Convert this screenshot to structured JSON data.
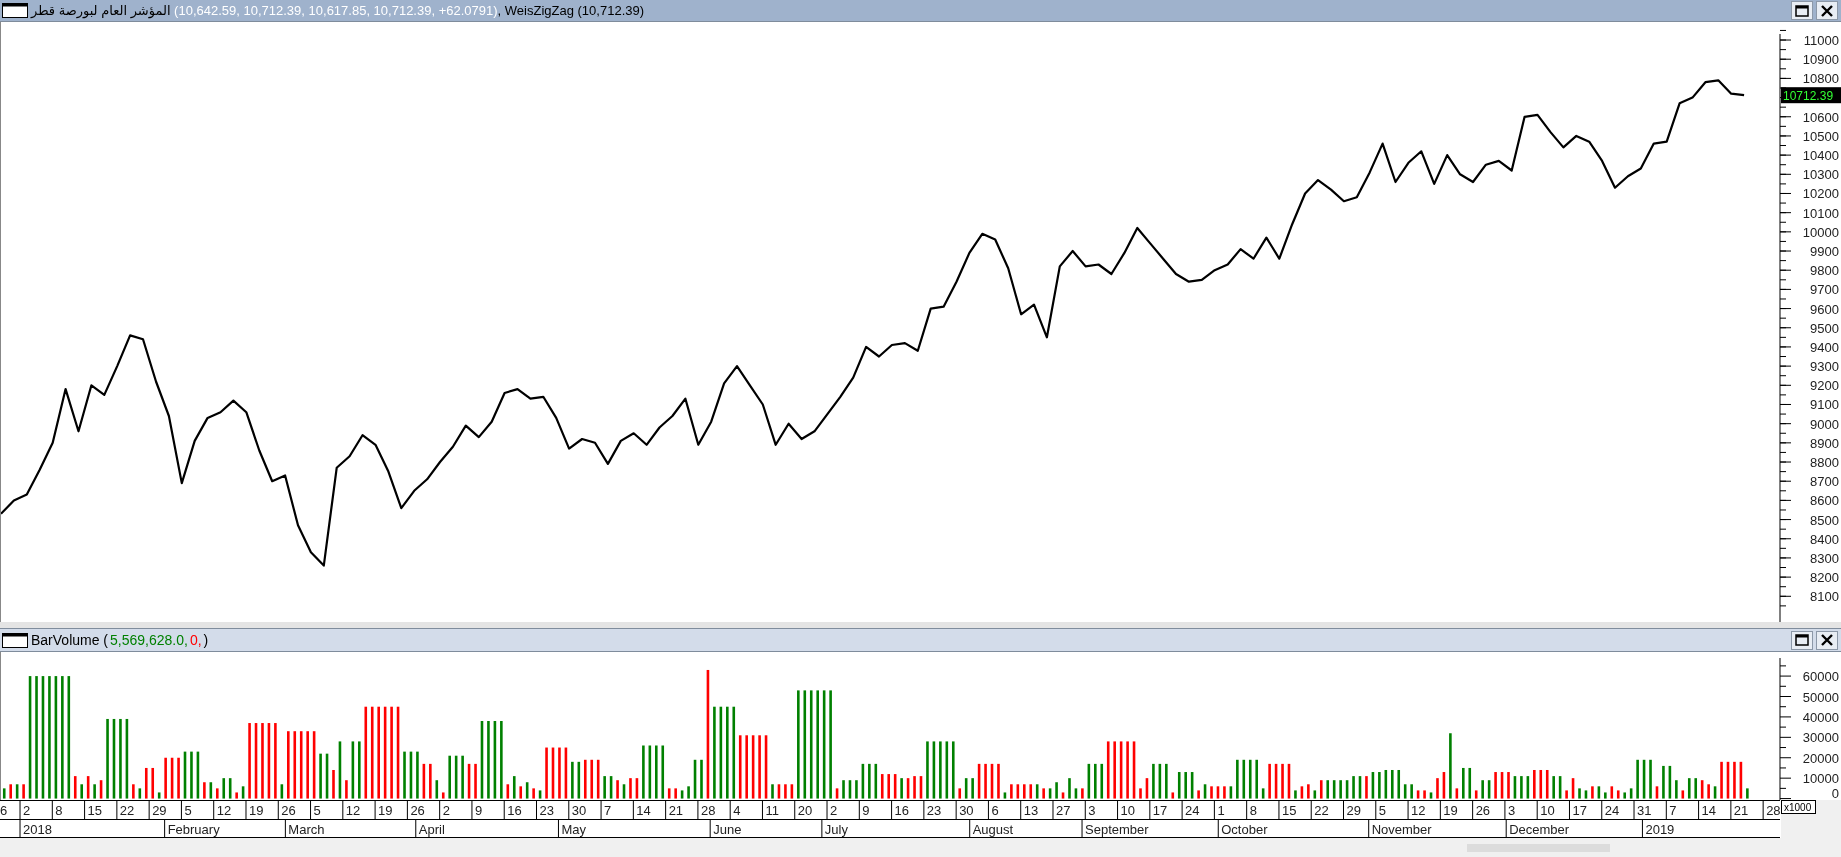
{
  "price_pane": {
    "title": [
      {
        "text": "المؤشر العام لبورصة قطر",
        "color": "#000000"
      },
      {
        "text": " (10,642.59, 10,712.39, 10,617.85, 10,712.39, +62.0791)",
        "color": "#ffffff"
      },
      {
        "text": ", WeisZigZag (10,712.39)",
        "color": "#000000"
      }
    ],
    "last_value": "10712.39",
    "chart_data": {
      "type": "line",
      "ylim": [
        7966,
        11094
      ],
      "yticks": [
        {
          "value": 8100,
          "label": "8100"
        },
        {
          "value": 8200,
          "label": "8200"
        },
        {
          "value": 8300,
          "label": "8300"
        },
        {
          "value": 8400,
          "label": "8400"
        },
        {
          "value": 8500,
          "label": "8500"
        },
        {
          "value": 8600,
          "label": "8600"
        },
        {
          "value": 8700,
          "label": "8700"
        },
        {
          "value": 8800,
          "label": "8800"
        },
        {
          "value": 8900,
          "label": "8900"
        },
        {
          "value": 9000,
          "label": "9000"
        },
        {
          "value": 9100,
          "label": "9100"
        },
        {
          "value": 9200,
          "label": "9200"
        },
        {
          "value": 9300,
          "label": "9300"
        },
        {
          "value": 9400,
          "label": "9400"
        },
        {
          "value": 9500,
          "label": "9500"
        },
        {
          "value": 9600,
          "label": "9600"
        },
        {
          "value": 9700,
          "label": "9700"
        },
        {
          "value": 9800,
          "label": "9800"
        },
        {
          "value": 9900,
          "label": "9900"
        },
        {
          "value": 10000,
          "label": "10000"
        },
        {
          "value": 10100,
          "label": "10100"
        },
        {
          "value": 10200,
          "label": "10200"
        },
        {
          "value": 10300,
          "label": "10300"
        },
        {
          "value": 10400,
          "label": "10400"
        },
        {
          "value": 10500,
          "label": "10500"
        },
        {
          "value": 10600,
          "label": "10600"
        },
        {
          "value": 10800,
          "label": "10800"
        },
        {
          "value": 10900,
          "label": "10900"
        },
        {
          "value": 11000,
          "label": "11000"
        }
      ],
      "categories": [
        null,
        null,
        null,
        null,
        null,
        null,
        null,
        null,
        null,
        null,
        null,
        null,
        null,
        null,
        null,
        null,
        null,
        null,
        null,
        null,
        null,
        null,
        null,
        null,
        null,
        null,
        null,
        null,
        null,
        null,
        null,
        null,
        null,
        null,
        null,
        null,
        null,
        null,
        null,
        null,
        null,
        null,
        null,
        null,
        null,
        null,
        null,
        null,
        null,
        null,
        null,
        null,
        null,
        null,
        null,
        null,
        null,
        null,
        null,
        null,
        null,
        null,
        null,
        null,
        null,
        null,
        null,
        null,
        null,
        null,
        null,
        null,
        null,
        null,
        null,
        null,
        null,
        null,
        null,
        null,
        null,
        null,
        null,
        null,
        null,
        null,
        null,
        null,
        null,
        null,
        null,
        null,
        null,
        null,
        null,
        null,
        null,
        null,
        null,
        null,
        null,
        null,
        null,
        null,
        null,
        null,
        null,
        null,
        null,
        null,
        null,
        null,
        null,
        null,
        null,
        null,
        null,
        null,
        null,
        null,
        null,
        null,
        null,
        null,
        null,
        null,
        null,
        null,
        null,
        null,
        null,
        null,
        null,
        null,
        null,
        null
      ],
      "series": [
        {
          "color": "#000000",
          "values": [
            8530,
            8600,
            8630,
            8760,
            8900,
            9180,
            8960,
            9200,
            9150,
            9300,
            9460,
            9440,
            9220,
            9040,
            8690,
            8910,
            9030,
            9060,
            9120,
            9060,
            8860,
            8700,
            8730,
            8470,
            8330,
            8260,
            8770,
            8830,
            8940,
            8890,
            8750,
            8560,
            8650,
            8710,
            8800,
            8880,
            8990,
            8930,
            9010,
            9160,
            9180,
            9130,
            9140,
            9030,
            8870,
            8920,
            8900,
            8790,
            8910,
            8950,
            8890,
            8980,
            9040,
            9130,
            8890,
            9010,
            9210,
            9300,
            9200,
            9100,
            8890,
            9000,
            8920,
            8960,
            9050,
            9140,
            9240,
            9400,
            9350,
            9410,
            9420,
            9380,
            9600,
            9610,
            9740,
            9890,
            9990,
            9960,
            9810,
            9570,
            9620,
            9450,
            9820,
            9900,
            9820,
            9830,
            9780,
            9890,
            10020,
            9940,
            9860,
            9780,
            9740,
            9750,
            9800,
            9830,
            9910,
            9860,
            9970,
            9860,
            10040,
            10200,
            10270,
            10220,
            10160,
            10180,
            10310,
            10460,
            10260,
            10360,
            10420,
            10250,
            10400,
            10300,
            10260,
            10350,
            10370,
            10320,
            10600,
            10610,
            10520,
            10440,
            10500,
            10470,
            10370,
            10230,
            10290,
            10330,
            10460,
            10470,
            10670,
            10700,
            10780,
            10790,
            10720,
            10712.39
          ]
        }
      ]
    }
  },
  "volume_pane": {
    "title": [
      {
        "text": "BarVolume (",
        "color": "#000000"
      },
      {
        "text": "5,569,628.0,",
        "color": "#008000"
      },
      {
        "text": "0,",
        "color": "#ff0000"
      },
      {
        "text": ")",
        "color": "#000000"
      }
    ],
    "scale_label": "x1000",
    "chart_data": {
      "type": "bar",
      "stacked": true,
      "ylim": [
        -700,
        71800
      ],
      "yticks": [
        {
          "value": 0,
          "label": "0"
        },
        {
          "value": 10000,
          "label": "10000"
        },
        {
          "value": 20000,
          "label": "20000"
        },
        {
          "value": 30000,
          "label": "30000"
        },
        {
          "value": 40000,
          "label": "40000"
        },
        {
          "value": 50000,
          "label": "50000"
        },
        {
          "value": 60000,
          "label": "60000"
        }
      ],
      "series": [
        {
          "color": "#008000",
          "values": [
            5000,
            null,
            7000,
            null,
            60000,
            60000,
            60000,
            60000,
            60000,
            60000,
            60000,
            null,
            7000,
            null,
            7000,
            null,
            39000,
            39000,
            39000,
            39000,
            null,
            5000,
            null,
            null,
            3000,
            null,
            null,
            null,
            23000,
            23000,
            23000,
            null,
            8000,
            null,
            10000,
            10000,
            null,
            6000,
            null,
            null,
            null,
            null,
            null,
            7000,
            null,
            null,
            null,
            null,
            null,
            22000,
            22000,
            null,
            28000,
            null,
            28000,
            28000,
            null,
            null,
            null,
            null,
            null,
            null,
            23000,
            23000,
            23000,
            null,
            null,
            9000,
            null,
            21000,
            21000,
            21000,
            null,
            null,
            38000,
            38000,
            38000,
            38000,
            null,
            11000,
            null,
            8000,
            null,
            4000,
            null,
            null,
            null,
            null,
            18000,
            18000,
            null,
            null,
            null,
            11000,
            11000,
            null,
            7000,
            null,
            null,
            26000,
            26000,
            26000,
            26000,
            null,
            null,
            4000,
            6000,
            19000,
            19000,
            null,
            45000,
            45000,
            45000,
            45000,
            null,
            null,
            null,
            null,
            null,
            7000,
            null,
            null,
            null,
            53000,
            53000,
            53000,
            53000,
            53000,
            53000,
            null,
            9000,
            9000,
            9000,
            17000,
            17000,
            17000,
            null,
            null,
            null,
            10000,
            null,
            null,
            null,
            28000,
            28000,
            28000,
            28000,
            28000,
            null,
            10000,
            10000,
            null,
            null,
            null,
            null,
            3000,
            null,
            null,
            null,
            null,
            7000,
            null,
            5000,
            8000,
            null,
            10000,
            5000,
            null,
            17000,
            17000,
            17000,
            null,
            null,
            null,
            null,
            null,
            null,
            null,
            17000,
            17000,
            17000,
            null,
            13000,
            13000,
            13000,
            null,
            7000,
            null,
            null,
            null,
            6000,
            19000,
            19000,
            19000,
            19000,
            5000,
            null,
            null,
            null,
            null,
            4000,
            null,
            null,
            4000,
            null,
            9000,
            9000,
            9000,
            9000,
            11000,
            11000,
            null,
            13000,
            13000,
            14000,
            14000,
            14000,
            7000,
            7000,
            null,
            null,
            3000,
            null,
            null,
            32000,
            null,
            15000,
            15000,
            null,
            9000,
            9000,
            null,
            null,
            null,
            11000,
            11000,
            11000,
            null,
            null,
            null,
            11000,
            11000,
            null,
            null,
            5000,
            4000,
            null,
            6000,
            3000,
            null,
            null,
            3000,
            5000,
            19000,
            19000,
            19000,
            null,
            16000,
            16000,
            9000,
            null,
            10000,
            10000,
            null,
            null,
            6000,
            null,
            null,
            null,
            null,
            5000
          ]
        },
        {
          "color": "#ff0000",
          "values": [
            null,
            7000,
            null,
            7000,
            null,
            null,
            null,
            null,
            null,
            null,
            null,
            11000,
            null,
            11000,
            null,
            9000,
            null,
            null,
            null,
            null,
            7000,
            null,
            15000,
            15000,
            null,
            20000,
            20000,
            20000,
            null,
            null,
            null,
            8000,
            null,
            5000,
            null,
            null,
            3000,
            null,
            37000,
            37000,
            37000,
            37000,
            37000,
            null,
            33000,
            33000,
            33000,
            33000,
            33000,
            null,
            null,
            14000,
            null,
            9000,
            null,
            null,
            45000,
            45000,
            45000,
            45000,
            45000,
            45000,
            null,
            null,
            null,
            17000,
            17000,
            null,
            3000,
            null,
            null,
            null,
            17000,
            17000,
            null,
            null,
            null,
            null,
            7000,
            null,
            6000,
            null,
            5000,
            null,
            25000,
            25000,
            25000,
            25000,
            null,
            null,
            19000,
            19000,
            19000,
            null,
            null,
            9000,
            null,
            10000,
            10000,
            null,
            null,
            null,
            null,
            5000,
            5000,
            null,
            null,
            null,
            null,
            63000,
            null,
            null,
            null,
            null,
            31000,
            31000,
            31000,
            31000,
            31000,
            null,
            7000,
            7000,
            7000,
            null,
            null,
            null,
            null,
            null,
            null,
            5000,
            null,
            null,
            null,
            null,
            null,
            null,
            12000,
            12000,
            12000,
            null,
            10000,
            11000,
            11000,
            null,
            null,
            null,
            null,
            null,
            5000,
            null,
            null,
            17000,
            17000,
            17000,
            17000,
            null,
            7000,
            7000,
            7000,
            7000,
            null,
            5000,
            null,
            null,
            3000,
            null,
            null,
            5000,
            null,
            null,
            null,
            28000,
            28000,
            28000,
            28000,
            28000,
            5000,
            10000,
            null,
            null,
            null,
            3000,
            null,
            null,
            null,
            4000,
            null,
            6000,
            6000,
            6000,
            null,
            null,
            null,
            null,
            null,
            null,
            17000,
            17000,
            17000,
            17000,
            null,
            6000,
            7000,
            null,
            9000,
            null,
            null,
            null,
            null,
            null,
            null,
            11000,
            null,
            null,
            null,
            null,
            null,
            null,
            null,
            4000,
            4000,
            null,
            10000,
            13000,
            null,
            5000,
            null,
            null,
            4000,
            null,
            null,
            13000,
            13000,
            13000,
            null,
            null,
            null,
            14000,
            14000,
            14000,
            null,
            null,
            4000,
            10000,
            null,
            null,
            6000,
            null,
            null,
            6000,
            4000,
            null,
            null,
            null,
            null,
            null,
            6000,
            null,
            null,
            null,
            4000,
            null,
            null,
            9000,
            7000,
            null,
            18000,
            18000,
            18000,
            18000,
            null
          ]
        }
      ]
    },
    "week_labels": [
      "6",
      "2",
      "8",
      "15",
      "22",
      "29",
      "5",
      "12",
      "19",
      "26",
      "5",
      "12",
      "19",
      "26",
      "2",
      "9",
      "16",
      "23",
      "30",
      "7",
      "14",
      "21",
      "28",
      "4",
      "11",
      "20",
      "2",
      "9",
      "16",
      "23",
      "30",
      "6",
      "13",
      "27",
      "3",
      "10",
      "17",
      "24",
      "1",
      "8",
      "15",
      "22",
      "29",
      "5",
      "12",
      "19",
      "26",
      "3",
      "10",
      "17",
      "24",
      "31",
      "7",
      "14",
      "21",
      "28"
    ],
    "months": [
      "2018",
      "February",
      "March",
      "April",
      "May",
      "June",
      "July",
      "August",
      "September",
      "October",
      "November",
      "December",
      "2019"
    ]
  }
}
